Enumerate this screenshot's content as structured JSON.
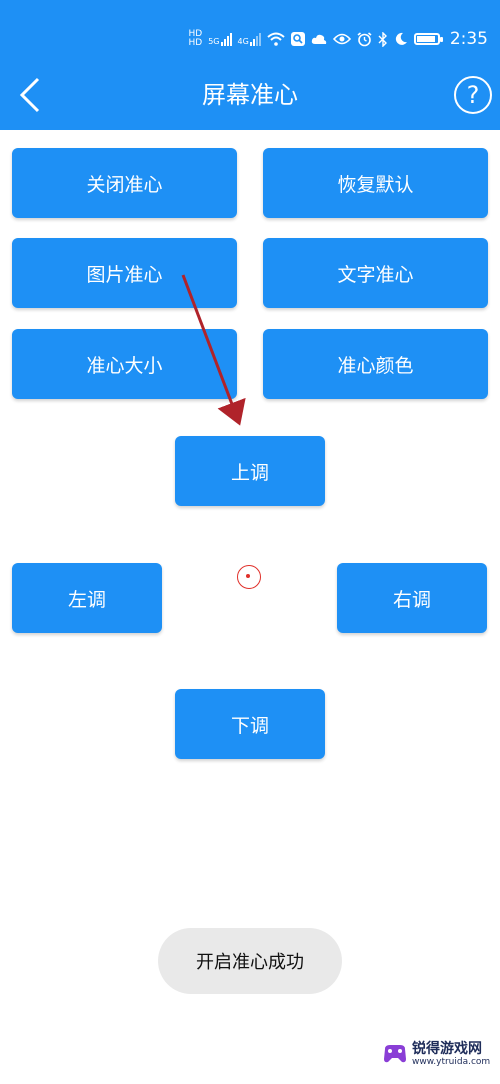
{
  "status_bar": {
    "hd1": "HD",
    "hd2": "HD",
    "signal1": "5G",
    "signal2": "4G",
    "time": "2:35"
  },
  "app_bar": {
    "title": "屏幕准心",
    "help": "?"
  },
  "buttons": {
    "close_crosshair": "关闭准心",
    "restore_default": "恢复默认",
    "image_crosshair": "图片准心",
    "text_crosshair": "文字准心",
    "crosshair_size": "准心大小",
    "crosshair_color": "准心颜色",
    "move_up": "上调",
    "move_left": "左调",
    "move_right": "右调",
    "move_down": "下调"
  },
  "toast": {
    "message": "开启准心成功"
  },
  "watermark": {
    "text": "锐得游戏网",
    "url": "www.ytruida.com"
  },
  "colors": {
    "primary": "#1e90f5",
    "annotation_arrow": "#b0232a",
    "crosshair": "#e0302a",
    "toast_bg": "#e9e9e9"
  }
}
